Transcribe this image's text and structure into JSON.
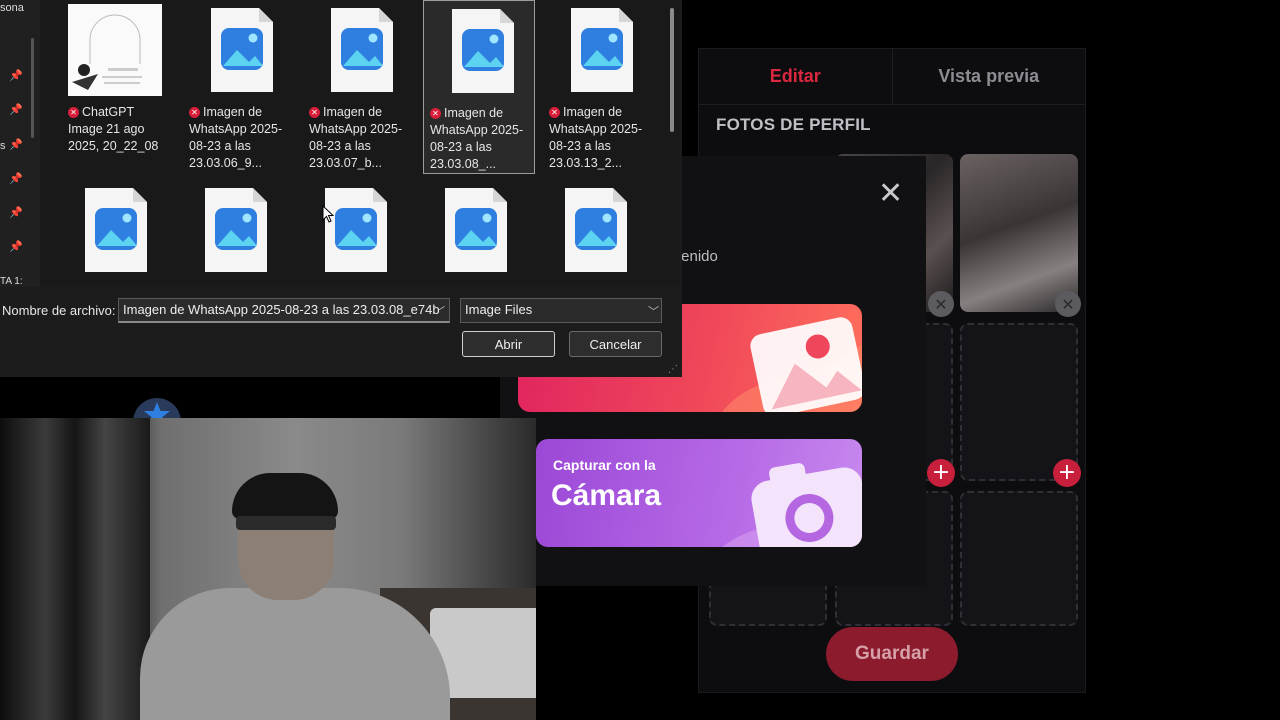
{
  "dialog": {
    "sidebar_truncated": [
      "sona",
      "s",
      "TA 1:"
    ],
    "files": [
      {
        "name": "ChatGPT Image 21 ago 2025, 20_22_08",
        "type": "thumbnail",
        "error": true,
        "selected": false
      },
      {
        "name": "Imagen de WhatsApp 2025-08-23 a las 23.03.06_9...",
        "type": "image",
        "error": true,
        "selected": false
      },
      {
        "name": "Imagen de WhatsApp 2025-08-23 a las 23.03.07_b...",
        "type": "image",
        "error": true,
        "selected": false
      },
      {
        "name": "Imagen de WhatsApp 2025-08-23 a las 23.03.08_...",
        "type": "image",
        "error": true,
        "selected": true
      },
      {
        "name": "Imagen de WhatsApp 2025-08-23 a las 23.03.13_2...",
        "type": "image",
        "error": true,
        "selected": false
      }
    ],
    "filename_label": "Nombre de archivo:",
    "filename_value": "Imagen de WhatsApp 2025-08-23 a las 23.03.08_e74b",
    "filetype_value": "Image Files",
    "open_label": "Abrir",
    "cancel_label": "Cancelar"
  },
  "app": {
    "tab_edit": "Editar",
    "tab_preview": "Vista previa",
    "section_title": "FOTOS DE PERFIL",
    "save_label": "Guardar",
    "accent": "#d9283f"
  },
  "modal": {
    "subtitle_partial": "tenido",
    "camera_small": "Capturar con la",
    "camera_big": "Cámara",
    "gallery_color": "#ef3b5c",
    "camera_color": "#b061e0"
  }
}
